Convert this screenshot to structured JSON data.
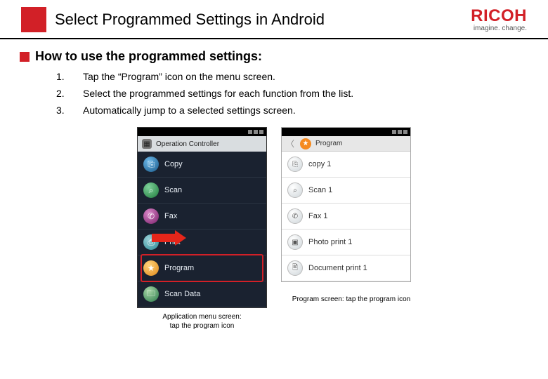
{
  "header": {
    "title": "Select Programmed Settings in Android",
    "logo": "RICOH",
    "tagline": "imagine. change."
  },
  "section": {
    "heading": "How to use the programmed settings:",
    "steps": [
      {
        "num": "1.",
        "text": "Tap the “Program” icon on the menu screen."
      },
      {
        "num": "2.",
        "text": "Select the programmed settings for each function from the list."
      },
      {
        "num": "3.",
        "text": "Automatically jump to a selected settings screen."
      }
    ]
  },
  "left_phone": {
    "header": "Operation Controller",
    "items": [
      {
        "label": "Copy"
      },
      {
        "label": "Scan"
      },
      {
        "label": "Fax"
      },
      {
        "label": "Print"
      },
      {
        "label": "Program"
      },
      {
        "label": "Scan Data"
      }
    ],
    "caption": "Application menu screen:\ntap the program icon"
  },
  "right_phone": {
    "header": "Program",
    "items": [
      {
        "label": "copy 1"
      },
      {
        "label": "Scan 1"
      },
      {
        "label": "Fax 1"
      },
      {
        "label": "Photo print 1"
      },
      {
        "label": "Document print 1"
      }
    ],
    "caption": "Program screen: tap the program icon"
  }
}
